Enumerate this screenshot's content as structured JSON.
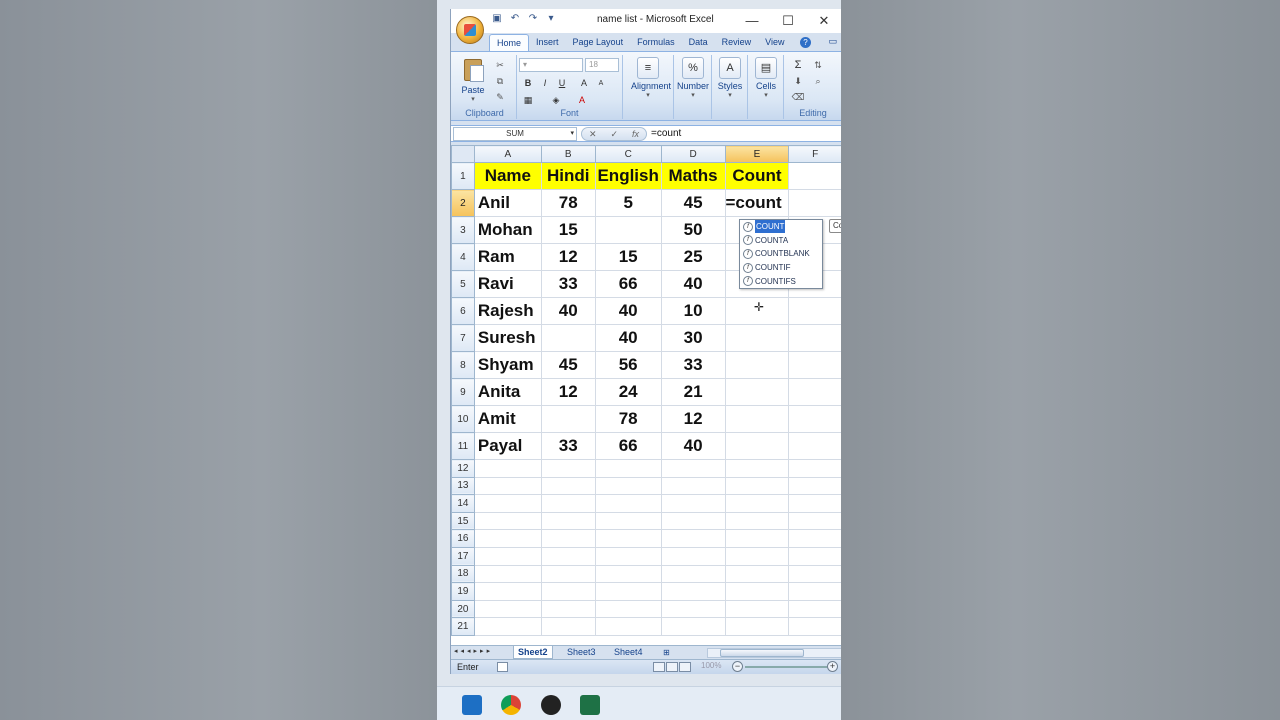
{
  "window": {
    "title": "name list - Microsoft Excel",
    "controls": [
      "—",
      "☐",
      "✕"
    ]
  },
  "ribbon": {
    "tabs": [
      "Home",
      "Insert",
      "Page Layout",
      "Formulas",
      "Data",
      "Review",
      "View"
    ],
    "active_tab": "Home",
    "groups": {
      "clipboard": {
        "label": "Clipboard",
        "paste": "Paste"
      },
      "font": {
        "label": "Font",
        "size": "18",
        "bold": "B",
        "italic": "I",
        "underline": "U"
      },
      "alignment": {
        "label": "Alignment"
      },
      "number": {
        "label": "Number",
        "symbol": "%"
      },
      "styles": {
        "label": "Styles"
      },
      "cells": {
        "label": "Cells"
      },
      "editing": {
        "label": "Editing",
        "sum": "Σ"
      }
    }
  },
  "formula_bar": {
    "name_box": "SUM",
    "fx": "fx",
    "value": "=count"
  },
  "sheet": {
    "columns": [
      "A",
      "B",
      "C",
      "D",
      "E",
      "F"
    ],
    "selected_column": "E",
    "header_row": [
      "Name",
      "Hindi",
      "English",
      "Maths",
      "Count"
    ],
    "rows": [
      [
        "Anil",
        "78",
        "5",
        "45",
        "=count"
      ],
      [
        "Mohan",
        "15",
        "",
        "50",
        ""
      ],
      [
        "Ram",
        "12",
        "15",
        "25",
        ""
      ],
      [
        "Ravi",
        "33",
        "66",
        "40",
        ""
      ],
      [
        "Rajesh",
        "40",
        "40",
        "10",
        ""
      ],
      [
        "Suresh",
        "",
        "40",
        "30",
        ""
      ],
      [
        "Shyam",
        "45",
        "56",
        "33",
        ""
      ],
      [
        "Anita",
        "12",
        "24",
        "21",
        ""
      ],
      [
        "Amit",
        "",
        "78",
        "12",
        ""
      ],
      [
        "Payal",
        "33",
        "66",
        "40",
        ""
      ]
    ],
    "row_numbers": [
      "1",
      "2",
      "3",
      "4",
      "5",
      "6",
      "7",
      "8",
      "9",
      "10",
      "11",
      "12",
      "13",
      "14",
      "15",
      "16",
      "17",
      "18",
      "19",
      "20",
      "21"
    ],
    "selected_row": "2"
  },
  "autocomplete": {
    "items": [
      "COUNT",
      "COUNTA",
      "COUNTBLANK",
      "COUNTIF",
      "COUNTIFS"
    ],
    "selected": "COUNT",
    "tooltip": "Co"
  },
  "sheet_tabs": [
    "Sheet2",
    "Sheet3",
    "Sheet4"
  ],
  "active_sheet": "Sheet2",
  "status": {
    "mode": "Enter",
    "zoom": "100%"
  },
  "colors": {
    "header_fill": "#ffff00",
    "selected_header": "#f5c25b",
    "autocomplete_selection": "#2f6fd0"
  },
  "taskbar": [
    "mail-icon",
    "chrome-icon",
    "app-icon",
    "excel-icon"
  ]
}
